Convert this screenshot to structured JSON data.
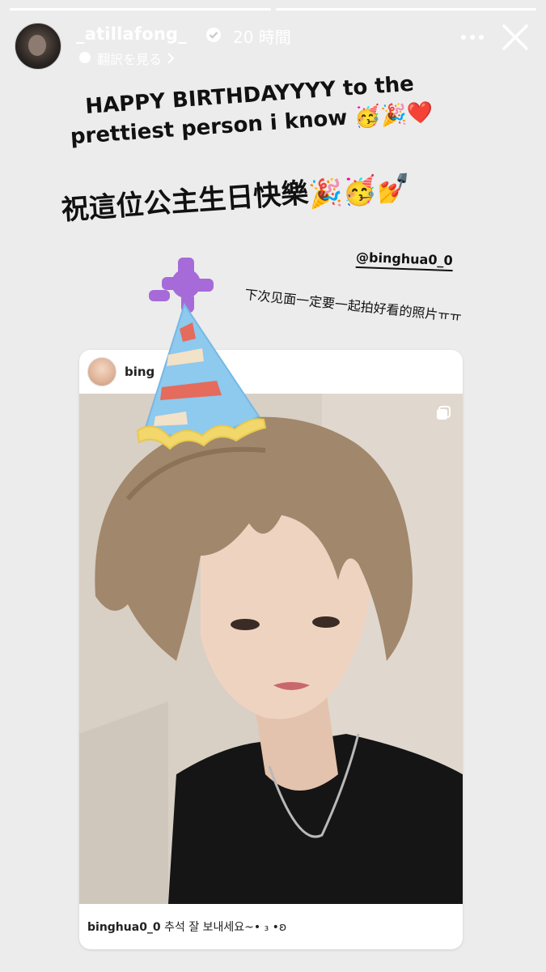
{
  "progress": {
    "segments": 2,
    "completed": 1
  },
  "header": {
    "username": "_atillafong_",
    "time_ago": "20 時間",
    "translate_label": "翻訳を見る"
  },
  "story": {
    "caption_line1": "HAPPY BIRTHDAYYYY to the",
    "caption_line2": "prettiest person i know",
    "caption_line2_emojis": "🥳🎉❤️",
    "chinese_caption": "祝這位公主生日快樂",
    "chinese_caption_emojis": "🎉🥳💅",
    "mention": "@binghua0_0",
    "note": "下次见面一定要一起拍好看的照片ㅠㅠ"
  },
  "shared_post": {
    "username": "binghua0_0",
    "username_partial": "bing",
    "caption_user": "binghua0_0",
    "caption_text": "추석 잘 보내세요~• ₃ •ʚ"
  },
  "colors": {
    "background": "#ececec",
    "hat_blue": "#8ec9ee",
    "hat_purple": "#a66bd8",
    "hat_yellow": "#f2d76a",
    "hat_stripe": "#e56b5d"
  },
  "icons": [
    "verified-badge-icon",
    "translate-icon",
    "chevron-right-icon",
    "more-icon",
    "close-icon",
    "multi-photo-icon"
  ]
}
